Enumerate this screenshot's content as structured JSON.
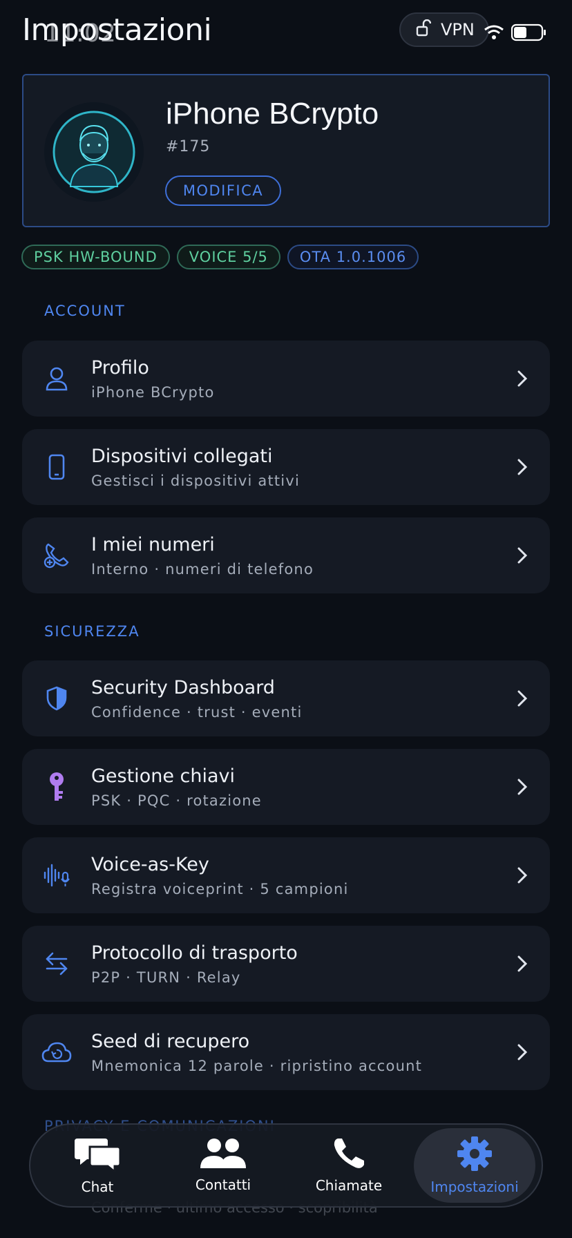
{
  "header": {
    "title": "Impostazioni",
    "time": "11:02",
    "vpn_label": "VPN"
  },
  "profile": {
    "name": "iPhone BCrypto",
    "number": "#175",
    "edit_label": "MODIFICA"
  },
  "badges": [
    {
      "label": "PSK HW-BOUND",
      "tone": "green"
    },
    {
      "label": "VOICE 5/5",
      "tone": "green"
    },
    {
      "label": "OTA 1.0.1006",
      "tone": "blue"
    }
  ],
  "sections": {
    "account": {
      "title": "ACCOUNT",
      "items": [
        {
          "title": "Profilo",
          "subtitle": "iPhone BCrypto",
          "icon": "person-icon"
        },
        {
          "title": "Dispositivi collegati",
          "subtitle": "Gestisci i dispositivi attivi",
          "icon": "phone-device-icon"
        },
        {
          "title": "I miei numeri",
          "subtitle": "Interno · numeri di telefono",
          "icon": "phone-add-icon"
        }
      ]
    },
    "security": {
      "title": "SICUREZZA",
      "items": [
        {
          "title": "Security Dashboard",
          "subtitle": "Confidence · trust · eventi",
          "icon": "shield-icon"
        },
        {
          "title": "Gestione chiavi",
          "subtitle": "PSK · PQC · rotazione",
          "icon": "key-icon"
        },
        {
          "title": "Voice-as-Key",
          "subtitle": "Registra voiceprint · 5 campioni",
          "icon": "voice-waveform-icon"
        },
        {
          "title": "Protocollo di trasporto",
          "subtitle": "P2P · TURN · Relay",
          "icon": "transfer-arrows-icon"
        },
        {
          "title": "Seed di recupero",
          "subtitle": "Mnemonica 12 parole · ripristino account",
          "icon": "cloud-restore-icon"
        }
      ]
    },
    "privacy": {
      "title": "PRIVACY E COMUNICAZIONI",
      "peek_subtitle": "Conferme · ultimo accesso · scopribilità"
    }
  },
  "nav": {
    "items": [
      {
        "label": "Chat",
        "icon": "chat-bubbles-icon",
        "active": false
      },
      {
        "label": "Contatti",
        "icon": "contacts-icon",
        "active": false
      },
      {
        "label": "Chiamate",
        "icon": "phone-icon",
        "active": false
      },
      {
        "label": "Impostazioni",
        "icon": "gear-icon",
        "active": true
      }
    ]
  },
  "colors": {
    "accent": "#4f86f0",
    "green": "#5fd0a0",
    "background": "#0b0f16",
    "row": "#151a24",
    "key": "#b07cf0"
  }
}
